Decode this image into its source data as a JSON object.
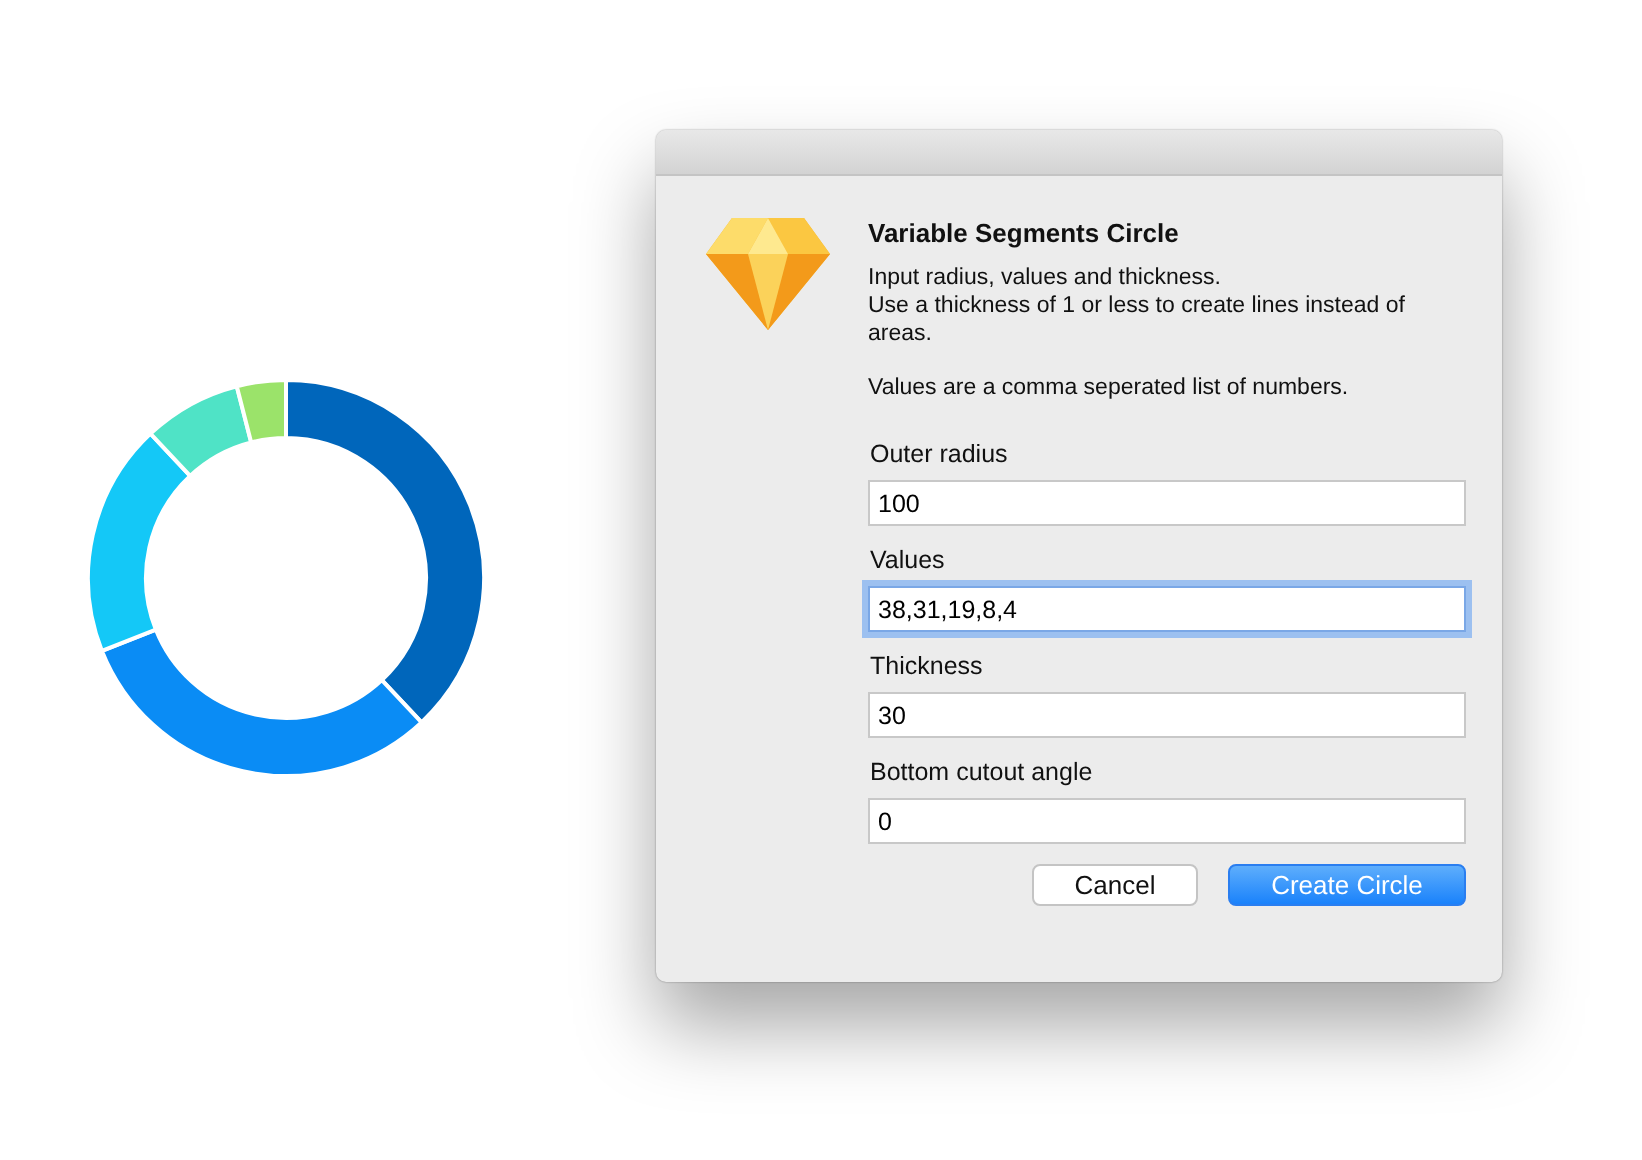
{
  "dialog": {
    "title": "Variable Segments Circle",
    "description": [
      "Input radius, values and thickness.",
      "Use a thickness of 1 or less to create lines instead of areas."
    ],
    "note": "Values are a comma seperated list of numbers.",
    "fields": [
      {
        "label": "Outer radius",
        "value": "100",
        "focused": false
      },
      {
        "label": "Values",
        "value": "38,31,19,8,4",
        "focused": true
      },
      {
        "label": "Thickness",
        "value": "30",
        "focused": false
      },
      {
        "label": "Bottom cutout angle",
        "value": "0",
        "focused": false
      }
    ],
    "buttons": [
      {
        "label": "Cancel",
        "kind": "secondary"
      },
      {
        "label": "Create Circle",
        "kind": "primary"
      }
    ]
  }
}
